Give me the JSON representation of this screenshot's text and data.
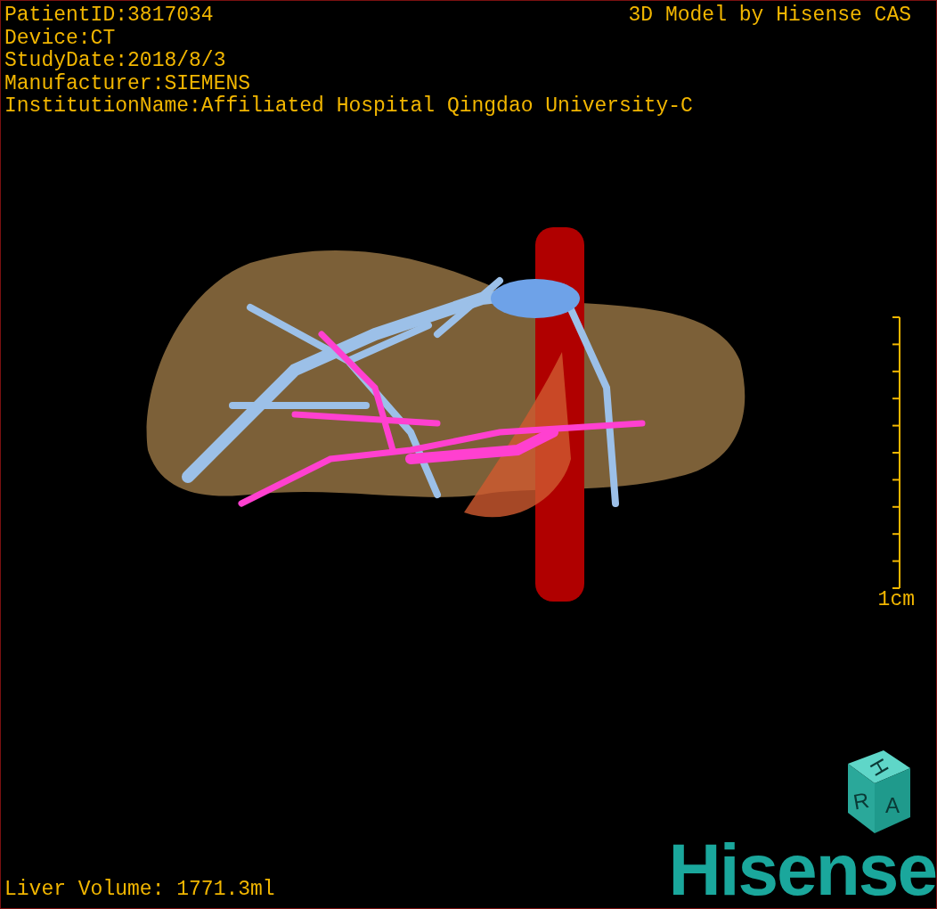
{
  "info_lines": [
    "PatientID:3817034",
    "Device:CT",
    "StudyDate:2018/8/3",
    "Manufacturer:SIEMENS",
    "InstitutionName:Affiliated Hospital Qingdao University-C"
  ],
  "title": "3D Model by Hisense CAS",
  "scale_bar": {
    "label": "1cm"
  },
  "orientation_cube": {
    "labels": [
      "H",
      "R",
      "A"
    ]
  },
  "liver_volume": "Liver Volume: 1771.3ml",
  "logo": "Hisense"
}
